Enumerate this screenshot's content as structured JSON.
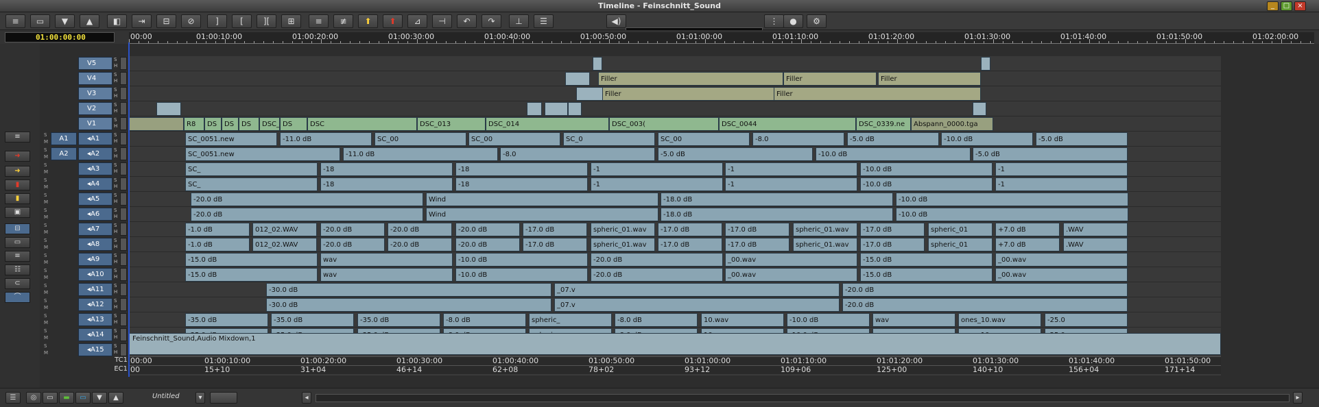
{
  "window": {
    "title": "Timeline - Feinschnitt_Sound"
  },
  "toolbar": {
    "icons": [
      "composer-icon",
      "select-icon",
      "lift-down-icon",
      "lift-up-icon",
      "trim-icon",
      "match-frame-icon",
      "sync-icon",
      "stop-icon",
      "mark-out-icon",
      "mark-in-icon",
      "mark-clip-icon",
      "clear-marks-icon",
      "segment-icon",
      "segment-alt-icon",
      "extract-icon",
      "lift-icon",
      "split-icon",
      "back-icon",
      "forward-icon",
      "splice-icon",
      "overwrite-icon",
      "audio-icon",
      "meter-icon",
      "record-icon",
      "settings-icon"
    ]
  },
  "timecode": {
    "current": "01:00:00:00"
  },
  "ruler": {
    "labels": [
      "00:00",
      "01:00:10:00",
      "01:00:20:00",
      "01:00:30:00",
      "01:00:40:00",
      "01:00:50:00",
      "01:01:00:00",
      "01:01:10:00",
      "01:01:20:00",
      "01:01:30:00",
      "01:01:40:00",
      "01:01:50:00",
      "01:02:00:00"
    ]
  },
  "tracks": [
    {
      "name": "V5"
    },
    {
      "name": "V4"
    },
    {
      "name": "V3"
    },
    {
      "name": "V2"
    },
    {
      "name": "V1"
    },
    {
      "src": "A1",
      "name": "A1"
    },
    {
      "src": "A2",
      "name": "A2"
    },
    {
      "name": "A3"
    },
    {
      "name": "A4"
    },
    {
      "name": "A5"
    },
    {
      "name": "A6"
    },
    {
      "name": "A7"
    },
    {
      "name": "A8"
    },
    {
      "name": "A9"
    },
    {
      "name": "A10"
    },
    {
      "name": "A11"
    },
    {
      "name": "A12"
    },
    {
      "name": "A13"
    },
    {
      "name": "A14"
    },
    {
      "name": "A15"
    }
  ],
  "tc_rows": {
    "tc1_label": "TC1",
    "ec1_label": "EC1",
    "tc1": [
      "00:00",
      "01:00:10:00",
      "01:00:20:00",
      "01:00:30:00",
      "01:00:40:00",
      "01:00:50:00",
      "01:01:00:00",
      "01:01:10:00",
      "01:01:20:00",
      "01:01:30:00",
      "01:01:40:00",
      "01:01:50:00"
    ],
    "ec1": [
      "00",
      "15+10",
      "31+04",
      "46+14",
      "62+08",
      "78+02",
      "93+12",
      "109+06",
      "125+00",
      "140+10",
      "156+04",
      "171+14"
    ]
  },
  "clips": {
    "filler": "Filler",
    "v1": [
      "R8",
      "DS",
      "DS",
      "DS",
      "DSC_",
      "DS",
      "DSC",
      "DSC_013",
      "DSC_014",
      "DSC_003(",
      "DSC_0044",
      "DSC_0339.ne",
      "Abspann_0000.tga"
    ],
    "a1": [
      "SC_0051.new",
      "-11.0 dB",
      "SC_00",
      "SC_00",
      "SC_0",
      "SC_00",
      "-8.0",
      "-5.0 dB",
      "-10.0 dB",
      "-5.0 dB"
    ],
    "a2": [
      "SC_0051.new",
      "-11.0 dB",
      "-8.0",
      "-5.0 dB",
      "-10.0 dB",
      "-5.0 dB"
    ],
    "a3": [
      "SC_",
      "-18",
      "-18",
      "-1",
      "-1",
      "-10.0 dB",
      "-1"
    ],
    "a4": [
      "SC_",
      "-18",
      "-18",
      "-1",
      "-1",
      "-10.0 dB",
      "-1"
    ],
    "a5": [
      "-20.0 dB",
      "Wind",
      "-18.0 dB",
      "-10.0 dB"
    ],
    "a6": [
      "-20.0 dB",
      "Wind",
      "-18.0 dB",
      "-10.0 dB"
    ],
    "a7": [
      "-1.0 dB",
      "012_02.WAV",
      "-20.0 dB",
      "-20.0 dB",
      "-20.0 dB",
      "-17.0 dB",
      "spheric_01.wav",
      "-17.0 dB",
      "-17.0 dB",
      "spheric_01.wav",
      "-17.0 dB",
      "spheric_01",
      "+7.0 dB",
      ".WAV"
    ],
    "a8": [
      "-1.0 dB",
      "012_02.WAV",
      "-20.0 dB",
      "-20.0 dB",
      "-20.0 dB",
      "-17.0 dB",
      "spheric_01.wav",
      "-17.0 dB",
      "-17.0 dB",
      "spheric_01.wav",
      "-17.0 dB",
      "spheric_01",
      "+7.0 dB",
      ".WAV"
    ],
    "a9": [
      "-15.0 dB",
      "wav",
      "-10.0 dB",
      "-20.0 dB",
      "_00.wav",
      "-15.0 dB",
      "_00.wav"
    ],
    "a10": [
      "-15.0 dB",
      "wav",
      "-10.0 dB",
      "-20.0 dB",
      "_00.wav",
      "-15.0 dB",
      "_00.wav"
    ],
    "a11": [
      "-30.0 dB",
      "_07.v",
      "-20.0 dB"
    ],
    "a12": [
      "-30.0 dB",
      "_07.v",
      "-20.0 dB"
    ],
    "a13": [
      "-35.0 dB",
      "-35.0 dB",
      "-35.0 dB",
      "-8.0 dB",
      "spheric_",
      "-8.0 dB",
      "10.wav",
      "-10.0 dB",
      "wav",
      "ones_10.wav",
      "-25.0"
    ],
    "a14": [
      "-35.0 dB",
      "-35.0 dB",
      "-35.0 dB",
      "-8.0 dB",
      "spheric_",
      "-8.0 dB",
      "10.wav",
      "-10.0 dB",
      "wav",
      "ones_10.wav",
      "-25.0"
    ],
    "a15": "Feinschnitt_Sound,Audio Mixdown,1"
  },
  "bottom": {
    "sequence_name": "Untitled"
  },
  "colors": {
    "audio_clip": "#8aa5b3",
    "video_clip": "#9bb2bd",
    "filler": "#a4a884",
    "timecode": "#f3e23b",
    "playhead": "#2a52c8"
  }
}
